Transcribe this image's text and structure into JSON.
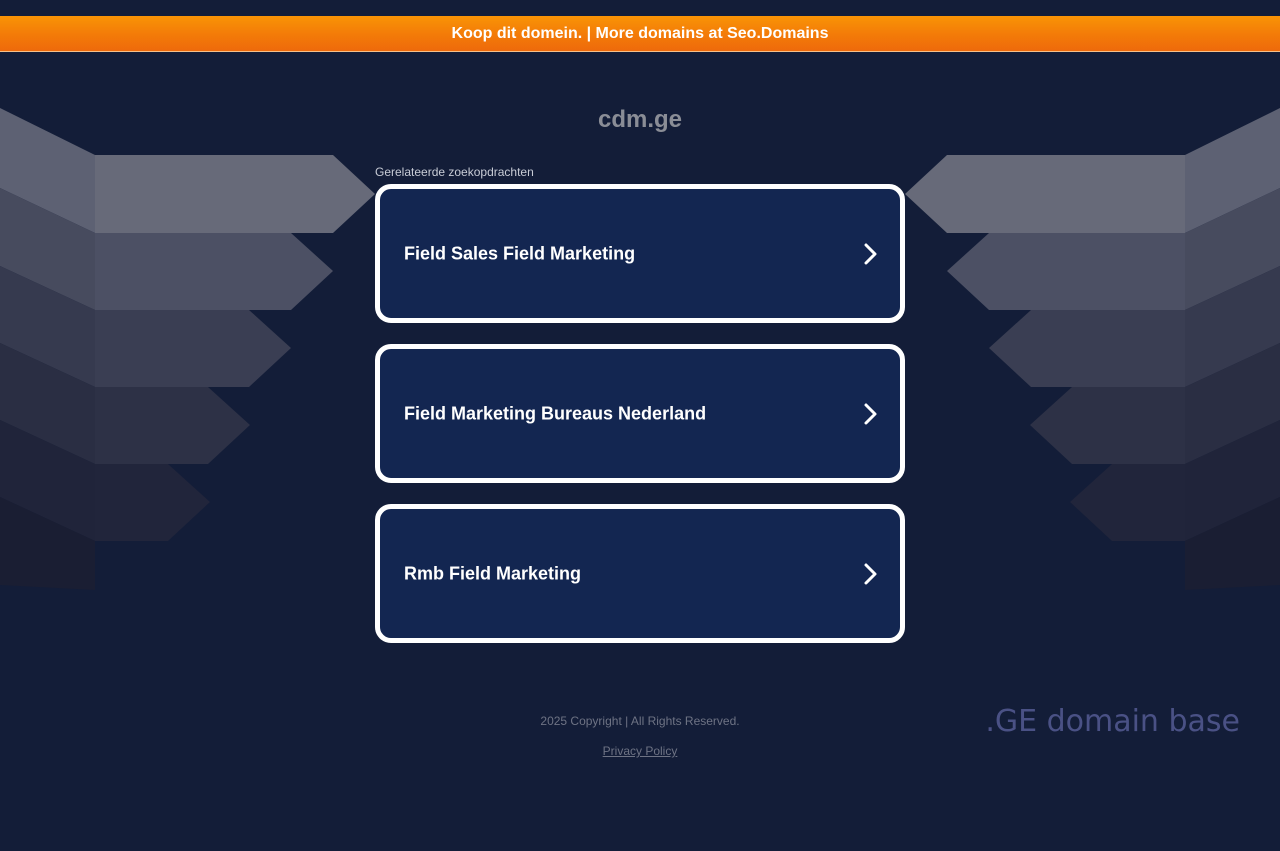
{
  "promo": {
    "text": "Koop dit domein. | More domains at Seo.Domains"
  },
  "domain": {
    "name": "cdm.ge"
  },
  "related": {
    "label": "Gerelateerde zoekopdrachten",
    "items": [
      {
        "label": "Field Sales Field Marketing",
        "icon": "chevron-right-icon"
      },
      {
        "label": "Field Marketing Bureaus Nederland",
        "icon": "chevron-right-icon"
      },
      {
        "label": "Rmb Field Marketing",
        "icon": "chevron-right-icon"
      }
    ]
  },
  "footer": {
    "copyright": "2025 Copyright | All Rights Reserved.",
    "privacy": "Privacy Policy"
  },
  "brand": {
    "mark": ".GE domain base"
  },
  "colors": {
    "background": "#131d38",
    "promo_orange": "#f37a08",
    "card_fill": "#132651",
    "card_border": "#ffffff",
    "brand_mark": "#4a5185"
  }
}
